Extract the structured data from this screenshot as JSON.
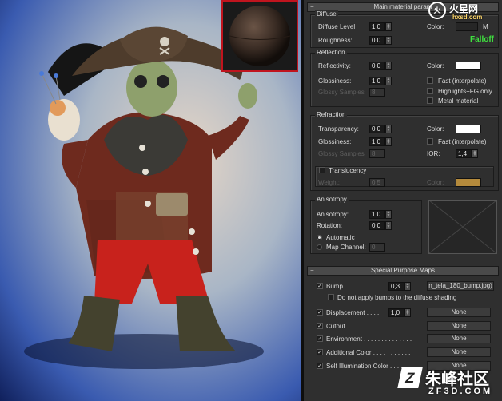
{
  "panel": {
    "main_header": "Main material param",
    "diffuse": {
      "title": "Diffuse",
      "level_label": "Diffuse Level",
      "level": "1,0",
      "color_label": "Color:",
      "color": "#262626",
      "map_btn": "M",
      "roughness_label": "Roughness:",
      "roughness": "0,0",
      "falloff": "Falloff"
    },
    "reflection": {
      "title": "Reflection",
      "reflectivity_label": "Reflectivity:",
      "reflectivity": "0,0",
      "color_label": "Color:",
      "color": "#ffffff",
      "glossiness_label": "Glossiness:",
      "glossiness": "1,0",
      "fast_label": "Fast (interpolate)",
      "glossy_samples_label": "Glossy Samples",
      "glossy_samples": "8",
      "highlights_label": "Highlights+FG only",
      "metal_label": "Metal material"
    },
    "refraction": {
      "title": "Refraction",
      "transparency_label": "Transparency:",
      "transparency": "0,0",
      "color_label": "Color:",
      "color": "#ffffff",
      "glossiness_label": "Glossiness:",
      "glossiness": "1,0",
      "fast_label": "Fast (interpolate)",
      "glossy_samples_label": "Glossy Samples",
      "glossy_samples": "8",
      "ior_label": "IOR:",
      "ior": "1,4",
      "translucency_label": "Translucency",
      "weight_label": "Weight:",
      "weight": "0,5",
      "tcolor_label": "Color:",
      "tcolor": "#b48a3c"
    },
    "anisotropy": {
      "title": "Anisotropy",
      "anisotropy_label": "Anisotropy:",
      "anisotropy": "1,0",
      "rotation_label": "Rotation:",
      "rotation": "0,0",
      "automatic_label": "Automatic",
      "map_channel_label": "Map Channel:",
      "map_channel": "0"
    },
    "special": {
      "header": "Special Purpose Maps",
      "bump_label": "Bump . . . . . . . . .",
      "bump": "0,3",
      "bump_map": "n_tela_180_bump.jpg)",
      "no_bump_label": "Do not apply bumps to the diffuse shading",
      "rows": [
        {
          "label": "Displacement . . . .",
          "value": "1,0",
          "map": "None"
        },
        {
          "label": "Cutout . . . . . . . . . . . . . . . . .",
          "map": "None"
        },
        {
          "label": "Environment . . . . . . . . . . . . . .",
          "map": "None"
        },
        {
          "label": "Additional Color . . . . . . . . . . .",
          "map": "None"
        },
        {
          "label": "Self Illumination Color . . . . . . .",
          "map": "None"
        }
      ]
    }
  },
  "watermark": {
    "top_brand": "火星网",
    "top_url": "hxsd.com",
    "bottom_brand": "朱峰社区",
    "bottom_url": "ZF3D.COM"
  }
}
